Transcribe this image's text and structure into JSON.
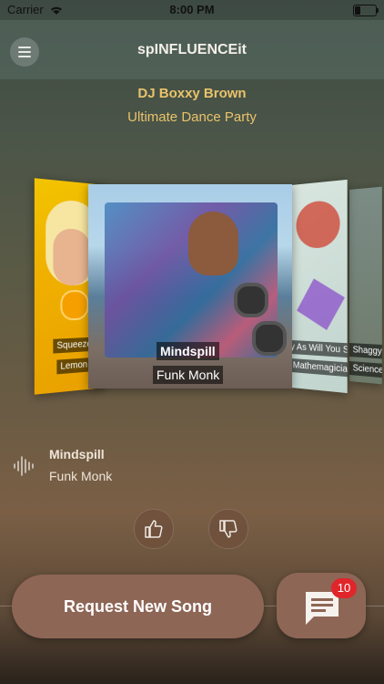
{
  "status": {
    "carrier": "Carrier",
    "time": "8:00 PM"
  },
  "header": {
    "title": "spINFLUENCEit"
  },
  "event": {
    "dj": "DJ Boxxy Brown",
    "party": "Ultimate Dance Party"
  },
  "carousel": {
    "left": {
      "title": "Squeeze My Juic",
      "artist": "Lemon Lovelles"
    },
    "current": {
      "title": "Mindspill",
      "artist": "Funk Monk"
    },
    "right": {
      "title": "Ly As Will You Subtr",
      "artist": "Mathemagicians"
    },
    "far_right": {
      "title": "Shaggy Dog",
      "artist": "Science"
    }
  },
  "now_playing": {
    "title": "Mindspill",
    "artist": "Funk Monk"
  },
  "actions": {
    "request_label": "Request New Song",
    "chat_badge": "10"
  },
  "colors": {
    "accent": "#e9c36b",
    "button": "#8e6656",
    "badge": "#e0262b"
  }
}
